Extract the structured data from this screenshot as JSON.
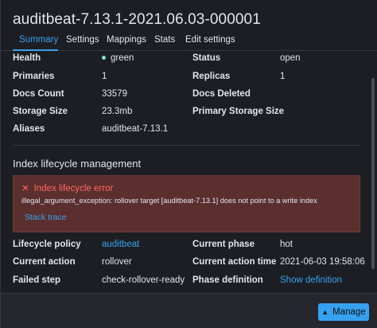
{
  "title": "auditbeat-7.13.1-2021.06.03-000001",
  "tabs": [
    {
      "label": "Summary",
      "active": true
    },
    {
      "label": "Settings",
      "active": false
    },
    {
      "label": "Mappings",
      "active": false
    },
    {
      "label": "Stats",
      "active": false
    },
    {
      "label": "Edit settings",
      "active": false
    }
  ],
  "summary": {
    "health_label": "Health",
    "health_value": "green",
    "status_label": "Status",
    "status_value": "open",
    "primaries_label": "Primaries",
    "primaries_value": "1",
    "replicas_label": "Replicas",
    "replicas_value": "1",
    "docs_count_label": "Docs Count",
    "docs_count_value": "33579",
    "docs_deleted_label": "Docs Deleted",
    "storage_size_label": "Storage Size",
    "storage_size_value": "23.3mb",
    "primary_storage_label": "Primary Storage Size",
    "aliases_label": "Aliases",
    "aliases_value": "auditbeat-7.13.1"
  },
  "ilm": {
    "section_title": "Index lifecycle management",
    "error_title": "Index lifecycle error",
    "error_message": "illegal_argument_exception: rollover target [auditbeat-7.13.1] does not point to a write index",
    "stack_trace_label": "Stack trace",
    "policy_label": "Lifecycle policy",
    "policy_value": "auditbeat",
    "phase_label": "Current phase",
    "phase_value": "hot",
    "action_label": "Current action",
    "action_value": "rollover",
    "action_time_label": "Current action time",
    "action_time_value": "2021-06-03 19:58:06",
    "failed_step_label": "Failed step",
    "failed_step_value": "check-rollover-ready",
    "phase_def_label": "Phase definition",
    "phase_def_value": "Show definition"
  },
  "footer": {
    "manage_label": "Manage"
  },
  "colors": {
    "accent": "#36a2ef",
    "health_green": "#7de2d1",
    "error_bg": "#5b2f2e",
    "error_text": "#ff6666"
  }
}
